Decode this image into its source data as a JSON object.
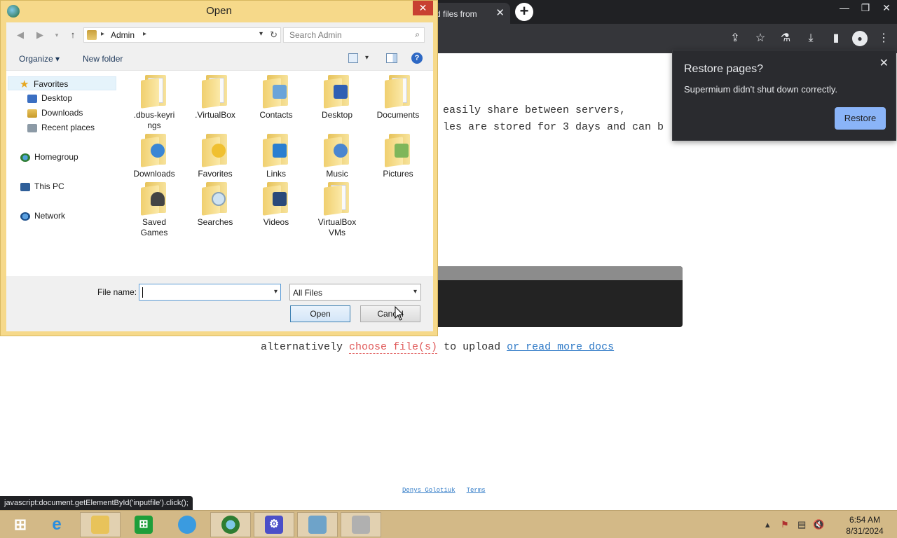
{
  "browser": {
    "tab_title": "d files from",
    "tab_close": "✕",
    "new_tab": "+",
    "window_controls": [
      "—",
      "❐",
      "✕"
    ],
    "toolbar_icons": [
      "share-icon",
      "star-icon",
      "extension-icon",
      "download-icon",
      "sidepanel-icon",
      "profile-icon",
      "menu-icon"
    ]
  },
  "page": {
    "intro_line1": "easily share between servers,",
    "intro_line2": "les are stored for 3 days and can b",
    "alt_prefix": "alternatively ",
    "alt_choose": "choose file(s)",
    "alt_middle": " to upload ",
    "alt_docs": "or read more docs",
    "footer_author": "Denys Golotiuk",
    "footer_terms": "Terms",
    "status_text": "javascript:document.getElementById('inputfile').click();"
  },
  "restore_popup": {
    "title": "Restore pages?",
    "message": "Supermium didn't shut down correctly.",
    "button": "Restore",
    "close": "✕",
    "button_color": "#8ab4f8"
  },
  "dialog": {
    "title": "Open",
    "close": "✕",
    "breadcrumb": "Admin",
    "search_placeholder": "Search Admin",
    "organize": "Organize ▾",
    "new_folder": "New folder",
    "help": "?",
    "nav": [
      {
        "label": "Favorites",
        "icon": "star-icon"
      },
      {
        "label": "Desktop",
        "icon": "desktop-icon"
      },
      {
        "label": "Downloads",
        "icon": "downloads-icon"
      },
      {
        "label": "Recent places",
        "icon": "recent-places-icon"
      },
      {
        "label": "Homegroup",
        "icon": "homegroup-icon"
      },
      {
        "label": "This PC",
        "icon": "pc-icon"
      },
      {
        "label": "Network",
        "icon": "network-icon"
      }
    ],
    "files": [
      {
        "label": ".dbus-keyri\nngs"
      },
      {
        "label": ".VirtualBox"
      },
      {
        "label": "Contacts"
      },
      {
        "label": "Desktop"
      },
      {
        "label": "Documents"
      },
      {
        "label": "Downloads"
      },
      {
        "label": "Favorites"
      },
      {
        "label": "Links"
      },
      {
        "label": "Music"
      },
      {
        "label": "Pictures"
      },
      {
        "label": "Saved\nGames"
      },
      {
        "label": "Searches"
      },
      {
        "label": "Videos"
      },
      {
        "label": "VirtualBox\nVMs"
      }
    ],
    "file_name_label": "File name:",
    "file_name_value": "",
    "file_type": "All Files",
    "open_button": "Open",
    "cancel_button": "Cancel"
  },
  "taskbar": {
    "time": "6:54 AM",
    "date": "8/31/2024",
    "apps": [
      "start-icon",
      "ie-icon",
      "file-explorer-icon",
      "store-icon",
      "app-icon",
      "browser-icon",
      "settings-icon",
      "control-panel-icon",
      "archive-icon"
    ]
  }
}
